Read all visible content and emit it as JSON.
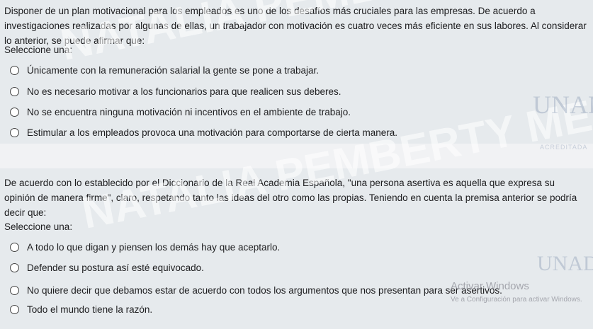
{
  "question1": {
    "text": "Disponer de un plan motivacional para los empleados es uno de los desafíos más cruciales para las empresas. De acuerdo a investigaciones realizadas por algunas de ellas, un trabajador con motivación es cuatro veces más eficiente en sus labores. Al considerar lo anterior, se puede afirmar que:",
    "select_label": "Seleccione una:",
    "options": [
      "Únicamente con la remuneración salarial la gente se pone a trabajar.",
      "No es necesario motivar a los funcionarios para que realicen sus deberes.",
      "No se encuentra ninguna motivación ni incentivos en el ambiente de trabajo.",
      "Estimular a los empleados provoca una motivación para comportarse de cierta manera."
    ]
  },
  "question2": {
    "text": "De acuerdo con lo establecido por el Diccionario de la Real Academia Española, \"una persona asertiva es aquella que expresa su opinión de manera firme\", claro, respetando tanto las ideas del otro como las propias. Teniendo en cuenta la premisa anterior se podría decir que:",
    "select_label": "Seleccione una:",
    "options": [
      "A todo lo que digan y piensen los demás hay que aceptarlo.",
      "Defender su postura así esté equivocado.",
      "No quiere decir que debamos estar de acuerdo con todos los argumentos que nos presentan para ser asertivos.",
      "Todo el mundo tiene la razón."
    ]
  },
  "watermark": {
    "line1": "NATALIA PEMBERTY MERCHAN",
    "line2": "NATALIA PEMBERTY MERCHAN",
    "logo": "UNAD",
    "logo_sub": "ACREDITADA"
  },
  "activation": {
    "title": "Activar Windows",
    "subtitle": "Ve a Configuración para activar Windows."
  },
  "colors": {
    "panel": "#e6eaed",
    "background": "#f1f2f4",
    "text": "#1d1d1f"
  }
}
